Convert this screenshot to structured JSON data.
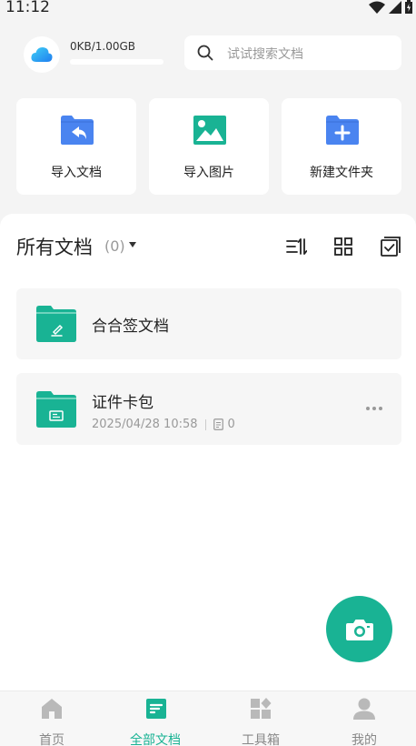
{
  "status_bar": {
    "time": "11:12",
    "icons": [
      "wifi-icon",
      "signal-icon",
      "battery-icon"
    ]
  },
  "storage": {
    "used_text": "0KB/1.00GB",
    "progress": 0.0,
    "icon": "cloud-icon"
  },
  "search": {
    "placeholder": "试试搜索文档"
  },
  "quick_actions": [
    {
      "label": "导入文档",
      "icon": "import-document-icon"
    },
    {
      "label": "导入图片",
      "icon": "import-image-icon"
    },
    {
      "label": "新建文件夹",
      "icon": "new-folder-icon"
    }
  ],
  "documents_section": {
    "title": "所有文档",
    "count": "(0)",
    "tools": [
      "sort-icon",
      "grid-view-icon",
      "multi-select-icon"
    ]
  },
  "documents": [
    {
      "name": "合合签文档",
      "icon": "sign-folder-icon"
    },
    {
      "name": "证件卡包",
      "date": "2025/04/28 10:58",
      "file_count": "0",
      "icon": "id-card-folder-icon"
    }
  ],
  "fab": {
    "icon": "camera-icon"
  },
  "bottom_nav": [
    {
      "label": "首页",
      "icon": "home-icon",
      "active": false
    },
    {
      "label": "全部文档",
      "icon": "all-documents-icon",
      "active": true
    },
    {
      "label": "工具箱",
      "icon": "toolbox-icon",
      "active": false
    },
    {
      "label": "我的",
      "icon": "profile-icon",
      "active": false
    }
  ],
  "colors": {
    "accent": "#19b394",
    "action_blue": "#4a84f0",
    "background": "#f4f4f4"
  }
}
